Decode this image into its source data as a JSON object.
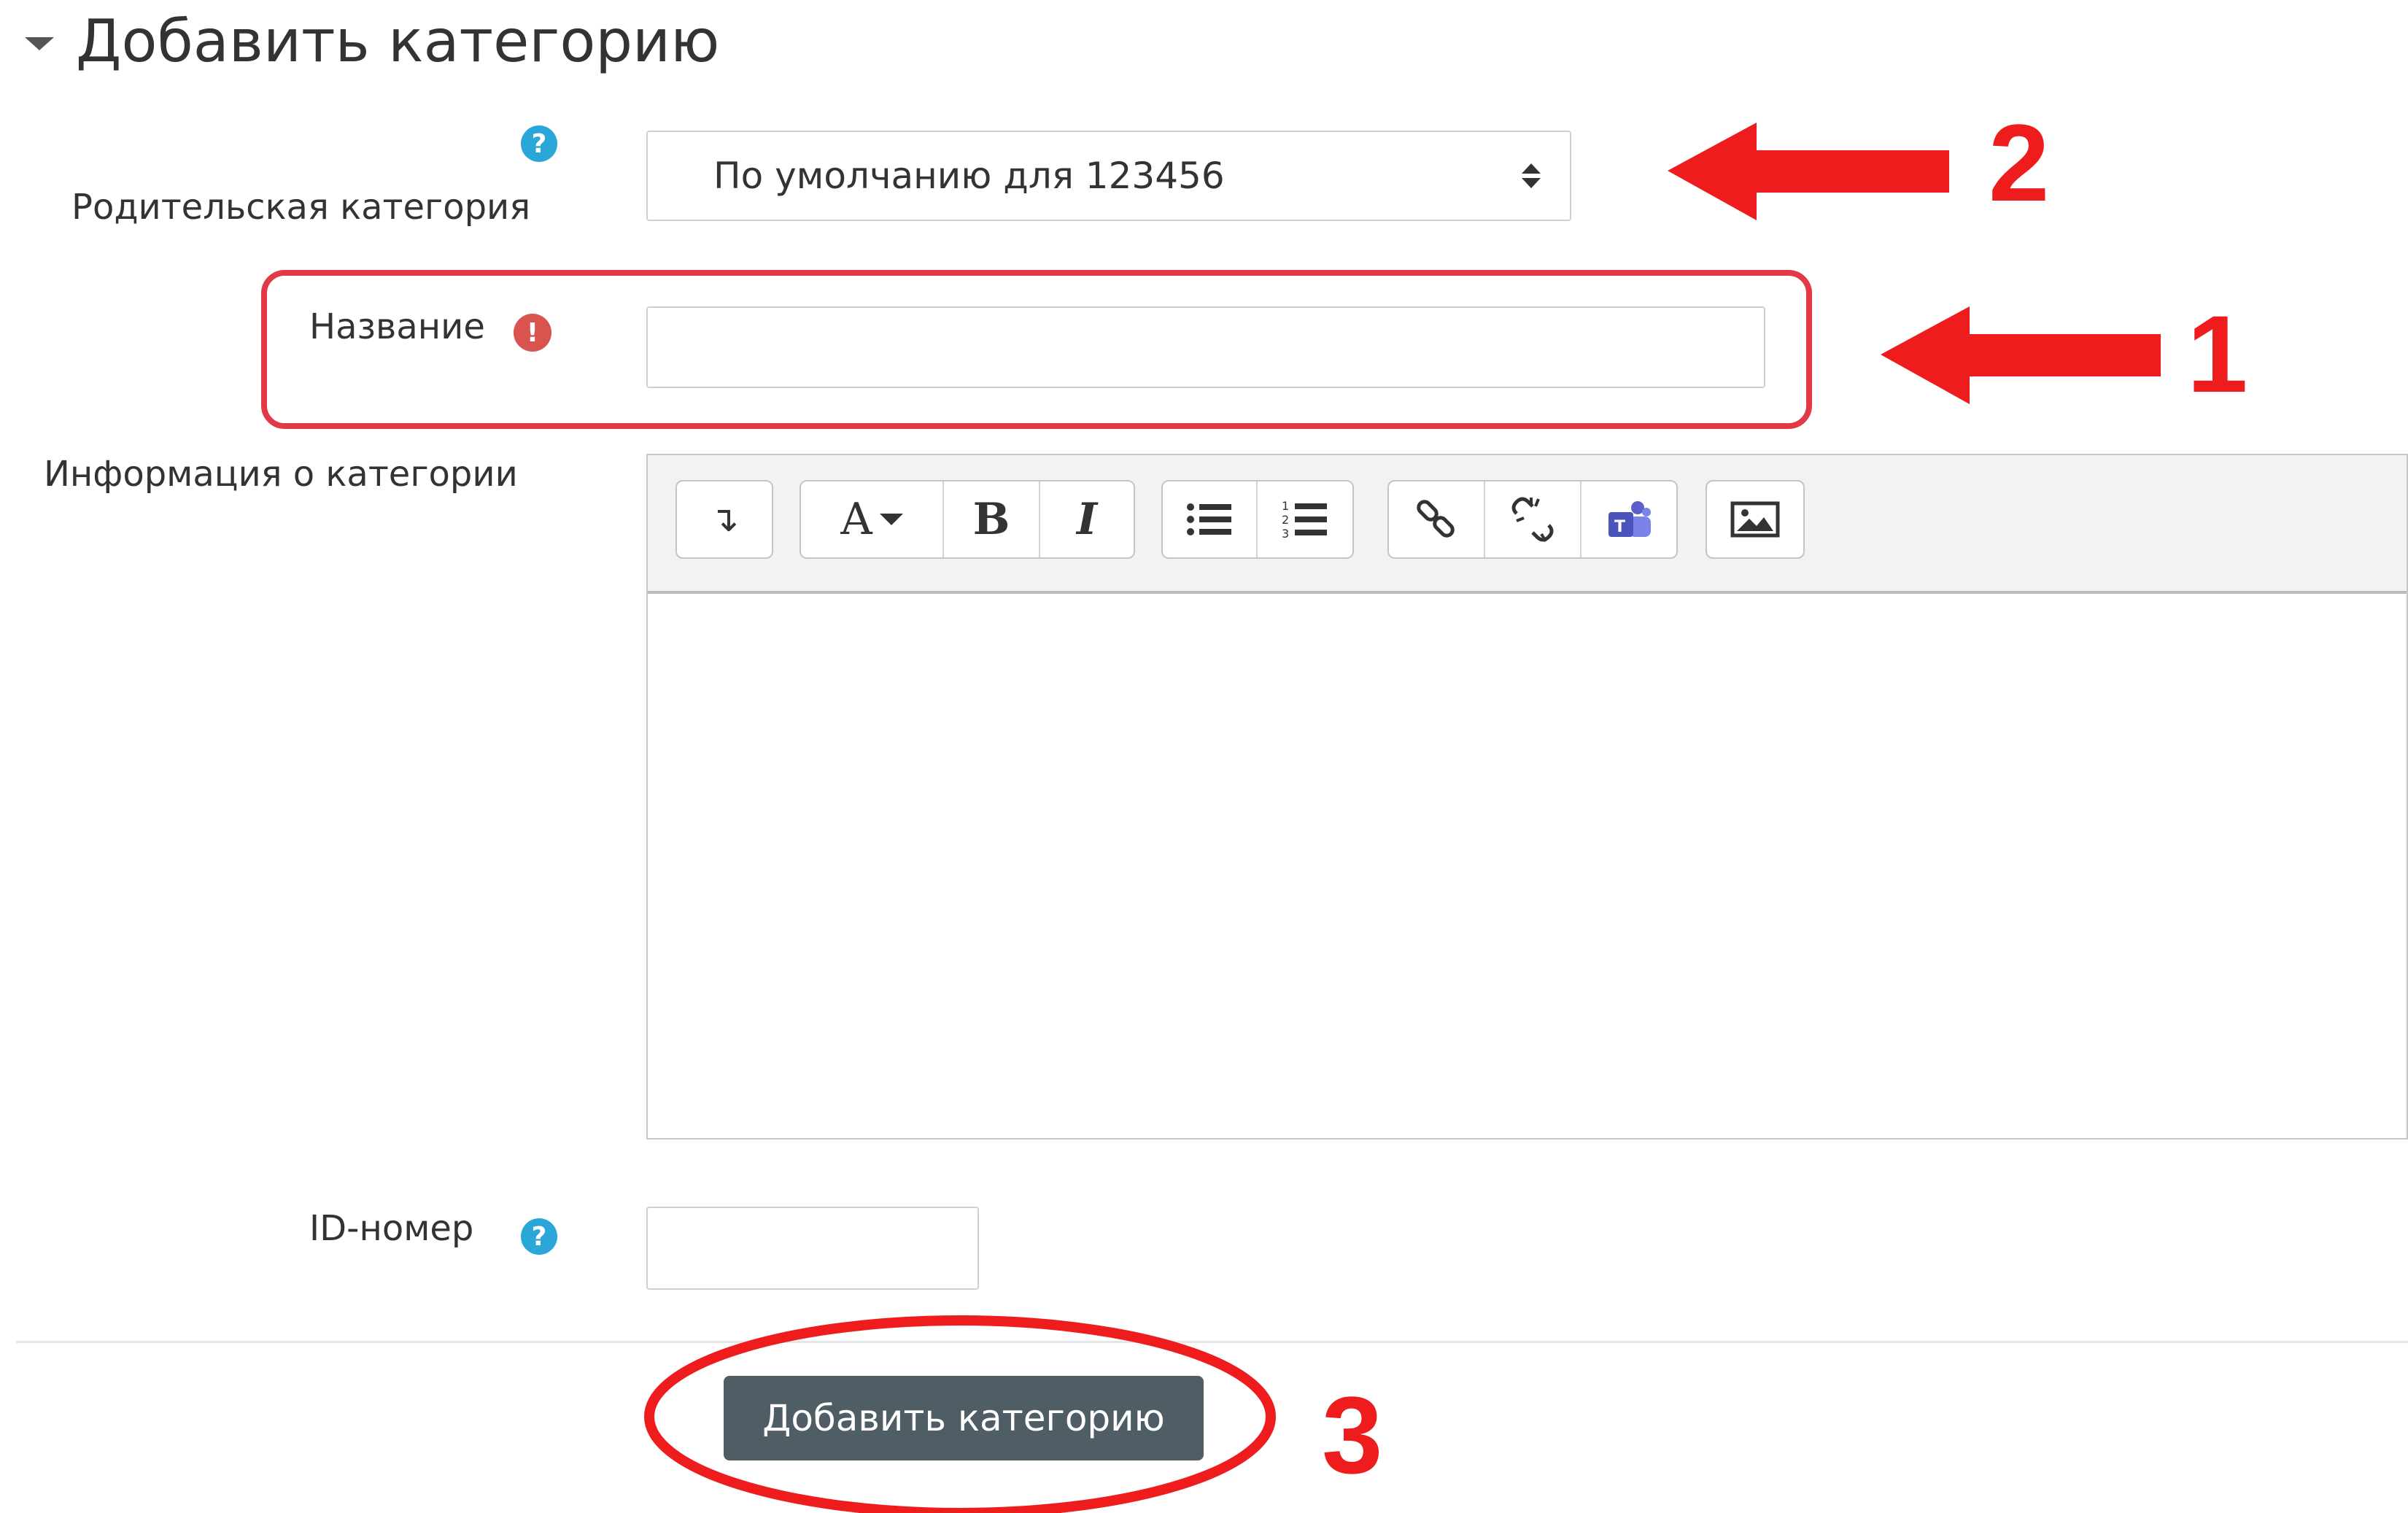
{
  "section": {
    "title": "Добавить категорию"
  },
  "parent_category": {
    "label": "Родительская категория",
    "selected": "По умолчанию для 123456"
  },
  "name": {
    "label": "Название",
    "value": ""
  },
  "description": {
    "label": "Информация о категории"
  },
  "toolbar": {
    "font_label": "A",
    "bold_label": "B",
    "italic_label": "I"
  },
  "idnumber": {
    "label": "ID-номер",
    "value": ""
  },
  "submit": {
    "label": "Добавить категорию"
  },
  "annotations": {
    "n1": "1",
    "n2": "2",
    "n3": "3",
    "accent_color": "#ee1c1c"
  }
}
